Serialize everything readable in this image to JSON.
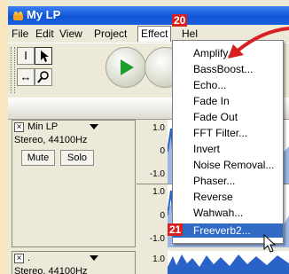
{
  "window": {
    "title": "My LP"
  },
  "menubar": {
    "items": [
      {
        "label": "File",
        "key": "F"
      },
      {
        "label": "Edit",
        "key": "E"
      },
      {
        "label": "View",
        "key": "V"
      },
      {
        "label": "Project",
        "key": "P"
      },
      {
        "label": "Effect",
        "key": "c"
      },
      {
        "label": "Help",
        "key": "H"
      }
    ],
    "help_visible": "Hel"
  },
  "ruler": {
    "label": "2"
  },
  "effect_menu": {
    "items": [
      "Amplify...",
      "BassBoost...",
      "Echo...",
      "Fade In",
      "Fade Out",
      "FFT Filter...",
      "Invert",
      "Noise Removal...",
      "Phaser...",
      "Reverse",
      "Wahwah...",
      "Freeverb2..."
    ],
    "highlighted": "Freeverb2..."
  },
  "callouts": {
    "effect_badge": "20",
    "freeverb_badge": "21"
  },
  "track1": {
    "name": "Min LP",
    "info": "Stereo, 44100Hz",
    "mute": "Mute",
    "solo": "Solo",
    "scale_top": [
      "1.0",
      "0",
      "-1.0"
    ],
    "scale_bottom": [
      "1.0",
      "0",
      "-1.0"
    ]
  },
  "track2": {
    "name": ".",
    "info": "Stereo, 44100Hz",
    "scale_top": "1.0"
  },
  "colors": {
    "titlebar": "#0f56d6",
    "highlight": "#316ac5",
    "callout": "#d7201f",
    "waveform": "#2a63c8",
    "background": "#f7e6bf"
  }
}
